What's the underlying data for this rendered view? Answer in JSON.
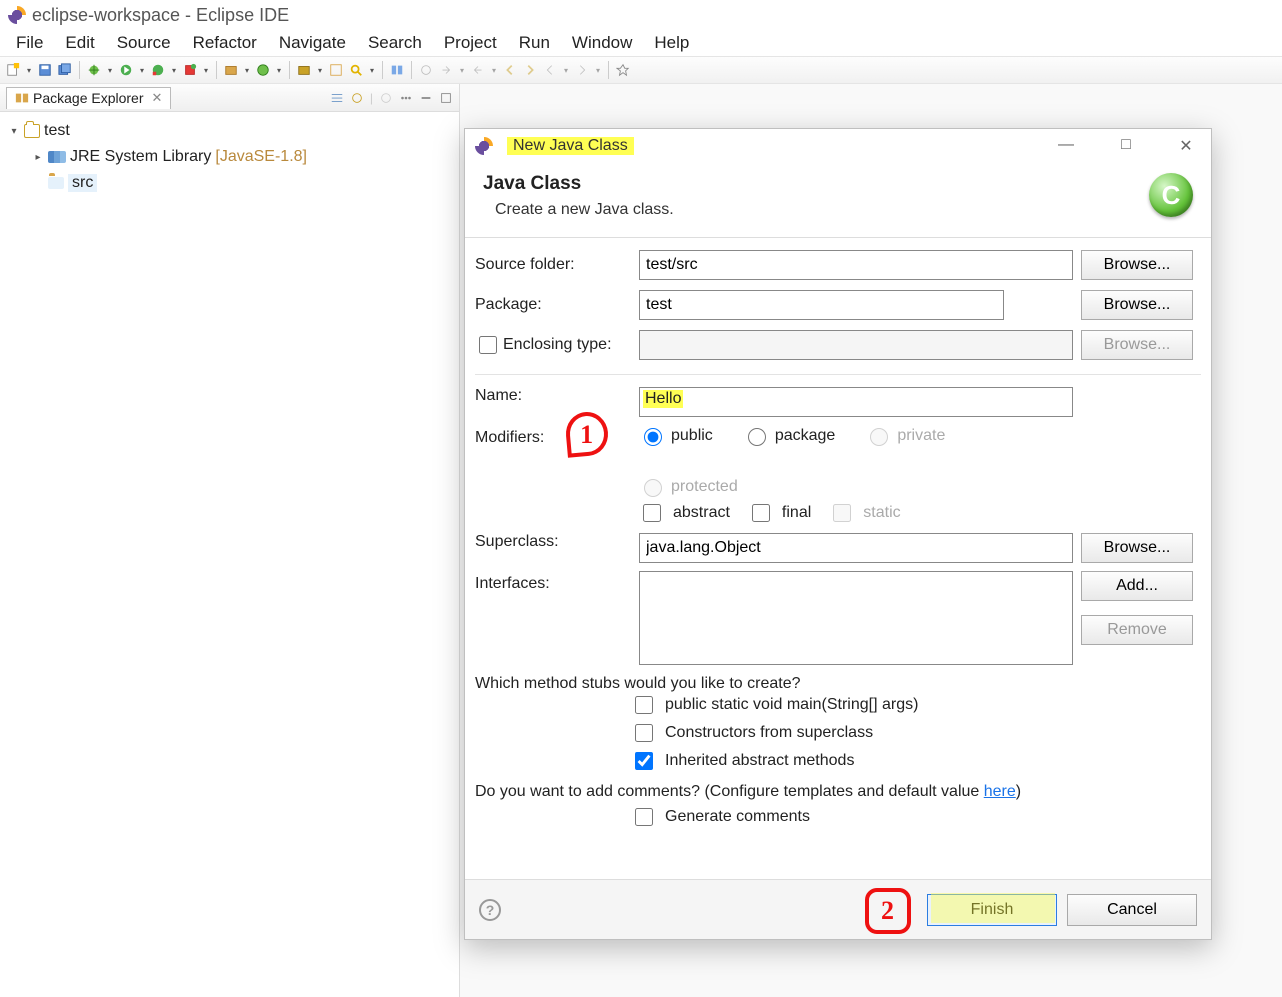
{
  "title": "eclipse-workspace - Eclipse IDE",
  "menu": [
    "File",
    "Edit",
    "Source",
    "Refactor",
    "Navigate",
    "Search",
    "Project",
    "Run",
    "Window",
    "Help"
  ],
  "pkg": {
    "tab": "Package Explorer",
    "tree": {
      "project": "test",
      "lib": "JRE System Library",
      "lib_suffix": "[JavaSE-1.8]",
      "pkg": "src"
    }
  },
  "dialog": {
    "title": "New Java Class",
    "banner_title": "Java Class",
    "banner_sub": "Create a new Java class.",
    "labels": {
      "source_folder": "Source folder:",
      "package": "Package:",
      "enclosing": "Enclosing type:",
      "name": "Name:",
      "modifiers": "Modifiers:",
      "superclass": "Superclass:",
      "interfaces": "Interfaces:",
      "stubs_q": "Which method stubs would you like to create?",
      "comments_q_prefix": "Do you want to add comments? (Configure templates and default value ",
      "comments_q_link": "here",
      "comments_q_suffix": ")"
    },
    "fields": {
      "source_folder": "test/src",
      "package": "test",
      "enclosing": "",
      "name": "Hello",
      "superclass": "java.lang.Object"
    },
    "modifiers": {
      "public": "public",
      "package": "package",
      "private": "private",
      "protected": "protected",
      "abstract": "abstract",
      "final": "final",
      "static": "static"
    },
    "stubs": {
      "main": "public static void main(String[] args)",
      "constructors": "Constructors from superclass",
      "inherited": "Inherited abstract methods"
    },
    "gen_comments": "Generate comments",
    "buttons": {
      "browse": "Browse...",
      "add": "Add...",
      "remove": "Remove",
      "finish": "Finish",
      "cancel": "Cancel"
    }
  }
}
